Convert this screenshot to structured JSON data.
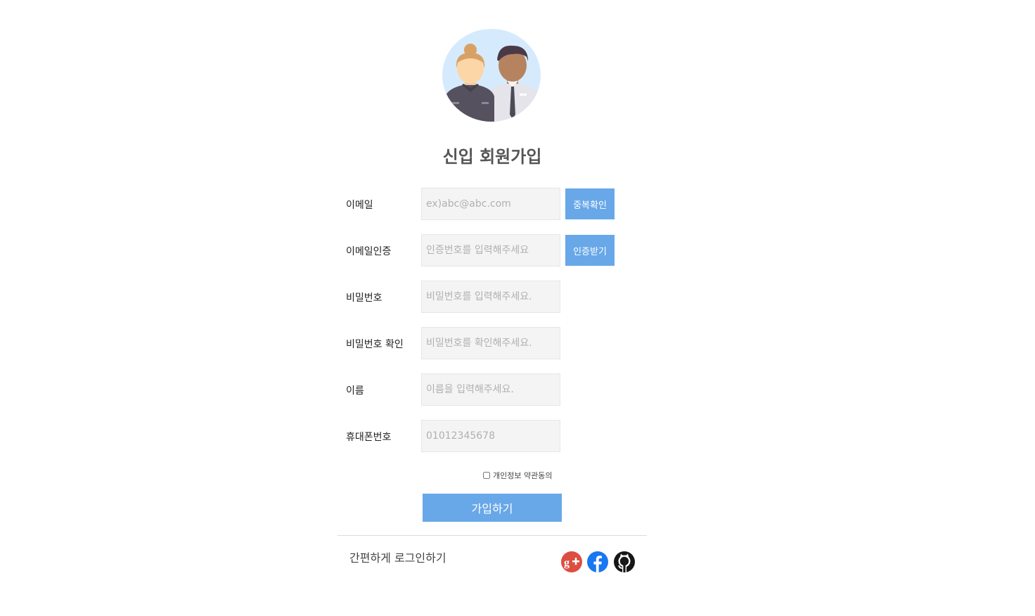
{
  "header": {
    "title": "신입 회원가입"
  },
  "form": {
    "fields": [
      {
        "label": "이메일",
        "placeholder": "ex)abc@abc.com",
        "value": "",
        "button": "중복확인"
      },
      {
        "label": "이메일인증",
        "placeholder": "인증번호를 입력해주세요",
        "value": "",
        "button": "인증받기"
      },
      {
        "label": "비밀번호",
        "placeholder": "비밀번호를 입력해주세요.",
        "value": ""
      },
      {
        "label": "비밀번호 확인",
        "placeholder": "비밀번호를 확인해주세요.",
        "value": ""
      },
      {
        "label": "이름",
        "placeholder": "이름을 입력해주세요.",
        "value": ""
      },
      {
        "label": "휴대폰번호",
        "placeholder": "01012345678",
        "value": ""
      }
    ],
    "agree_label": "개인정보 약관동의",
    "agree_checked": false,
    "submit_label": "가입하기"
  },
  "social": {
    "label": "간편하게 로그인하기",
    "icons": [
      "google-plus-icon",
      "facebook-icon",
      "github-icon"
    ]
  },
  "colors": {
    "accent": "#68a8e8",
    "input_bg": "#f4f4f4",
    "avatar_bg": "#d5ebfd"
  }
}
